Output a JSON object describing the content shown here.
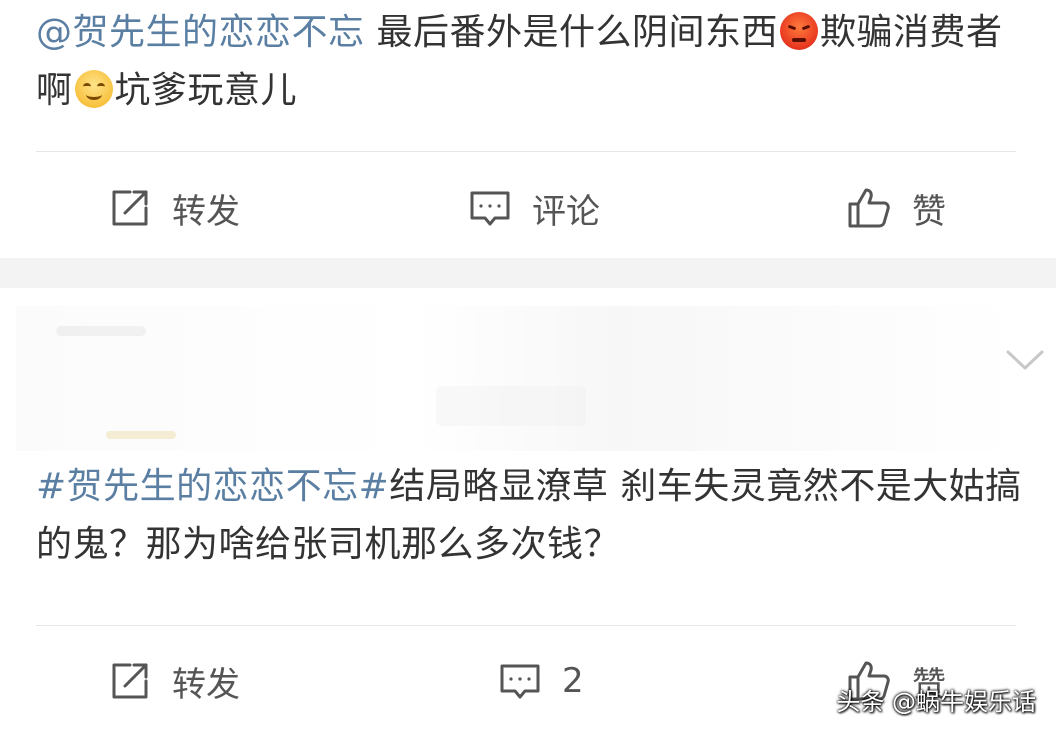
{
  "post1": {
    "mention": "@贺先生的恋恋不忘",
    "text_a": " 最后番外是什么阴间东西",
    "emoji_a": "angry-emoji",
    "text_b": "欺骗消费者啊",
    "emoji_b": "smile-emoji",
    "text_c": "坑爹玩意儿",
    "actions": {
      "repost_label": "转发",
      "comment_label": "评论",
      "like_label": "赞"
    }
  },
  "post2": {
    "hashtag": "#贺先生的恋恋不忘#",
    "text": "结局略显潦草 刹车失灵竟然不是大姑搞的鬼？那为啥给张司机那么多次钱？",
    "actions": {
      "repost_label": "转发",
      "comment_count": "2",
      "like_label": "赞"
    }
  },
  "watermark": "头条 @蜗牛娱乐话",
  "colors": {
    "link": "#5a7fa3",
    "text": "#333333",
    "icon": "#555555",
    "background": "#f3f3f3"
  },
  "icons": {
    "repost": "repost-icon",
    "comment": "comment-icon",
    "like": "thumbs-up-icon",
    "expand": "chevron-down-icon"
  }
}
